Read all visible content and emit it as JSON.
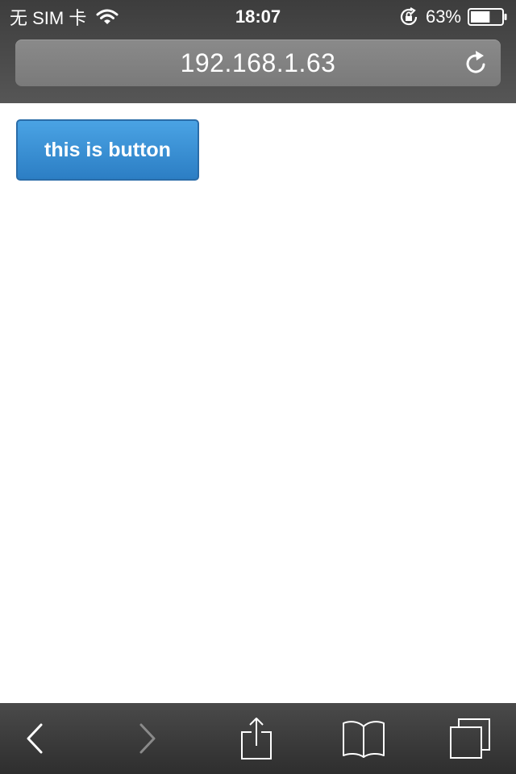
{
  "status_bar": {
    "carrier": "无 SIM 卡",
    "time": "18:07",
    "battery_percent": "63%",
    "battery_level": 0.63,
    "icons": [
      "wifi-icon",
      "rotation-lock-icon",
      "battery-icon"
    ]
  },
  "address_bar": {
    "url": "192.168.1.63",
    "reload_icon": "reload-icon"
  },
  "page": {
    "button_label": "this is button",
    "button_color": "#3a90d6"
  },
  "toolbar": {
    "items": [
      "back-icon",
      "forward-icon",
      "share-icon",
      "bookmarks-icon",
      "tabs-icon"
    ],
    "forward_enabled": false
  },
  "colors": {
    "chrome_dark": "#3d3d3d",
    "address_bar": "#838383",
    "button_blue": "#3a90d6",
    "button_border": "#2a6ca8"
  }
}
